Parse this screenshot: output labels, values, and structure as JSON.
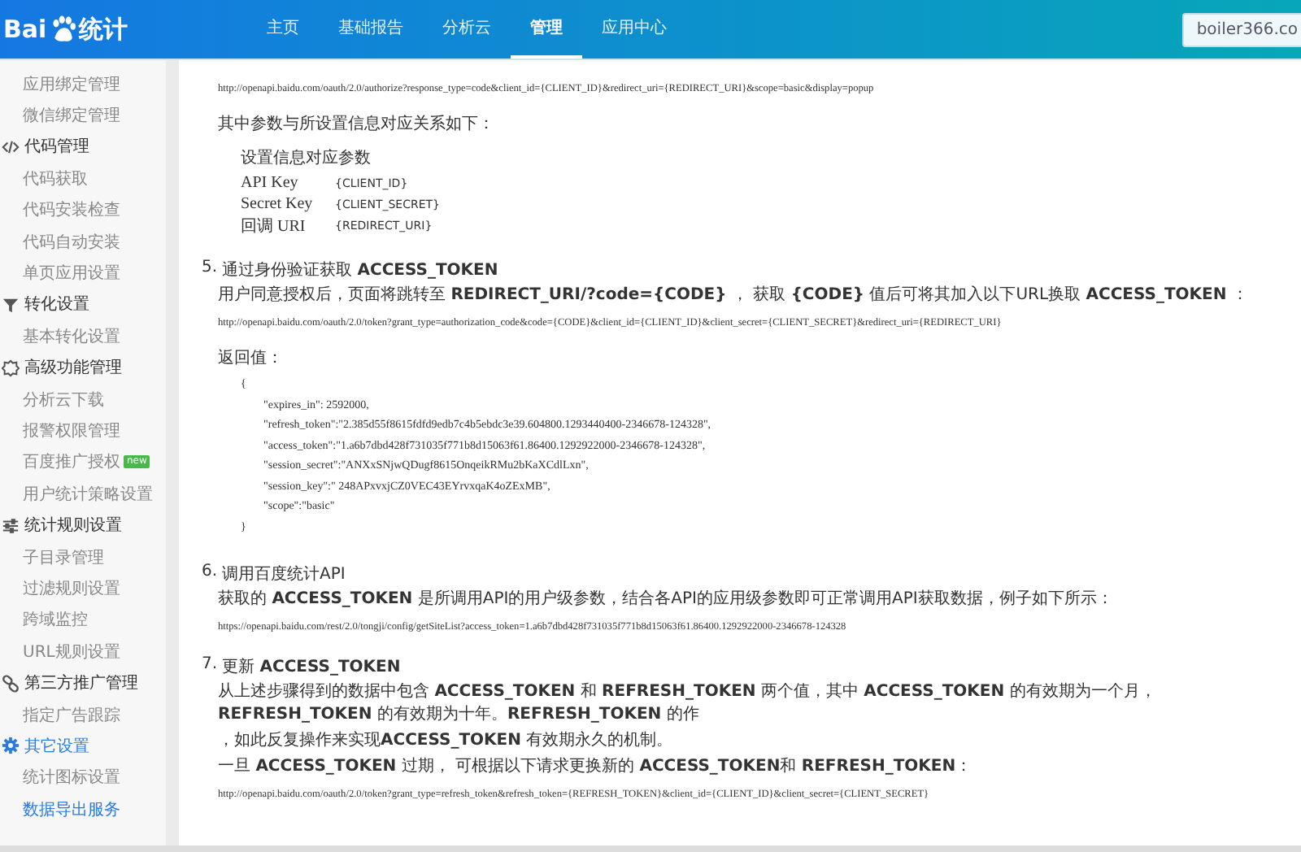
{
  "header": {
    "logo": {
      "text_left": "Bai",
      "text_right": "统计"
    },
    "nav": [
      {
        "label": "主页",
        "selected": false
      },
      {
        "label": "基础报告",
        "selected": false
      },
      {
        "label": "分析云",
        "selected": false
      },
      {
        "label": "管理",
        "selected": true
      },
      {
        "label": "应用中心",
        "selected": false
      }
    ],
    "account": "boiler366.co"
  },
  "sidebar": {
    "items": [
      {
        "kind": "link",
        "label": "应用绑定管理",
        "selected": false
      },
      {
        "kind": "link",
        "label": "微信绑定管理",
        "selected": false
      },
      {
        "kind": "group",
        "label": "代码管理",
        "selected": false
      },
      {
        "kind": "link",
        "label": "代码获取",
        "selected": false
      },
      {
        "kind": "link",
        "label": "代码安装检查",
        "selected": false
      },
      {
        "kind": "link",
        "label": "代码自动安装",
        "selected": false
      },
      {
        "kind": "link",
        "label": "单页应用设置",
        "selected": false
      },
      {
        "kind": "group",
        "label": "转化设置",
        "selected": false
      },
      {
        "kind": "link",
        "label": "基本转化设置",
        "selected": false
      },
      {
        "kind": "group",
        "label": "高级功能管理",
        "selected": false
      },
      {
        "kind": "link",
        "label": "分析云下载",
        "selected": false
      },
      {
        "kind": "link",
        "label": "报警权限管理",
        "selected": false
      },
      {
        "kind": "link",
        "label": "百度推广授权",
        "selected": false,
        "badge": "new"
      },
      {
        "kind": "link",
        "label": "用户统计策略设置",
        "selected": false
      },
      {
        "kind": "group",
        "label": "统计规则设置",
        "selected": false
      },
      {
        "kind": "link",
        "label": "子目录管理",
        "selected": false
      },
      {
        "kind": "link",
        "label": "过滤规则设置",
        "selected": false
      },
      {
        "kind": "link",
        "label": "跨域监控",
        "selected": false
      },
      {
        "kind": "link",
        "label": "URL规则设置",
        "selected": false
      },
      {
        "kind": "group",
        "label": "第三方推广管理",
        "selected": false
      },
      {
        "kind": "link",
        "label": "指定广告跟踪",
        "selected": false
      },
      {
        "kind": "group",
        "label": "其它设置",
        "selected": true
      },
      {
        "kind": "link",
        "label": "统计图标设置",
        "selected": false
      },
      {
        "kind": "link",
        "label": "数据导出服务",
        "selected": true
      }
    ]
  },
  "content": {
    "blocks": [
      {
        "kind": "code",
        "text": "http://openapi.baidu.com/oauth/2.0/authorize?response_type=code&client_id={CLIENT_ID}&redirect_uri={REDIRECT_URI}&scope=basic&display=popup"
      },
      {
        "kind": "para",
        "text": "其中参数与所设置信息对应关系如下："
      },
      {
        "kind": "params",
        "title": "设置信息对应参数",
        "rows": [
          [
            "API Key",
            "{CLIENT_ID}"
          ],
          [
            "Secret Key",
            "{CLIENT_SECRET}"
          ],
          [
            "回调 URI",
            "{REDIRECT_URI}"
          ]
        ]
      },
      {
        "kind": "step",
        "number": "5.",
        "text": "通过身份验证获取 **ACCESS_TOKEN**"
      },
      {
        "kind": "para",
        "text": "用户同意授权后，页面将跳转至 **REDIRECT_URI/?code={CODE}** ， 获取 **{CODE}** 值后可将其加入以下URL换取 **ACCESS_TOKEN** ："
      },
      {
        "kind": "code",
        "text": "http://openapi.baidu.com/oauth/2.0/token?grant_type=authorization_code&code={CODE}&client_id={CLIENT_ID}&client_secret={CLIENT_SECRET}&redirect_uri={REDIRECT_URI}"
      },
      {
        "kind": "para",
        "text": "返回值："
      },
      {
        "kind": "json",
        "lines": [
          "{",
          "\"expires_in\": 2592000,",
          "\"refresh_token\":\"2.385d55f8615fdfd9edb7c4b5ebdc3e39.604800.1293440400-2346678-124328\",",
          "\"access_token\":\"1.a6b7dbd428f731035f771b8d15063f61.86400.1292922000-2346678-124328\",",
          "\"session_secret\":\"ANXxSNjwQDugf8615OnqeikRMu2bKaXCdlLxn\",",
          "\"session_key\":\" 248APxvxjCZ0VEC43EYrvxqaK4oZExMB\",",
          "\"scope\":\"basic\"",
          "}"
        ]
      },
      {
        "kind": "step",
        "number": "6.",
        "text": "调用百度统计API"
      },
      {
        "kind": "para",
        "text": "获取的 **ACCESS_TOKEN** 是所调用API的用户级参数，结合各API的应用级参数即可正常调用API获取数据，例子如下所示："
      },
      {
        "kind": "code",
        "text": "https://openapi.baidu.com/rest/2.0/tongji/config/getSiteList?access_token=1.a6b7dbd428f731035f771b8d15063f61.86400.1292922000-2346678-124328"
      },
      {
        "kind": "step",
        "number": "7.",
        "text": "更新 **ACCESS_TOKEN**"
      },
      {
        "kind": "para",
        "text": "从上述步骤得到的数据中包含 **ACCESS_TOKEN** 和 **REFRESH_TOKEN** 两个值，其中 **ACCESS_TOKEN** 的有效期为一个月， **REFRESH_TOKEN** 的有效期为十年。**REFRESH_TOKEN** 的作"
      },
      {
        "kind": "para",
        "text": "，如此反复操作来实现**ACCESS_TOKEN** 有效期永久的机制。"
      },
      {
        "kind": "para",
        "text": "一旦 **ACCESS_TOKEN** 过期， 可根据以下请求更换新的 **ACCESS_TOKEN**和 **REFRESH_TOKEN**："
      },
      {
        "kind": "code",
        "text": "http://openapi.baidu.com/oauth/2.0/token?grant_type=refresh_token&refresh_token={REFRESH_TOKEN}&client_id={CLIENT_ID}&client_secret={CLIENT_SECRET}"
      }
    ]
  }
}
